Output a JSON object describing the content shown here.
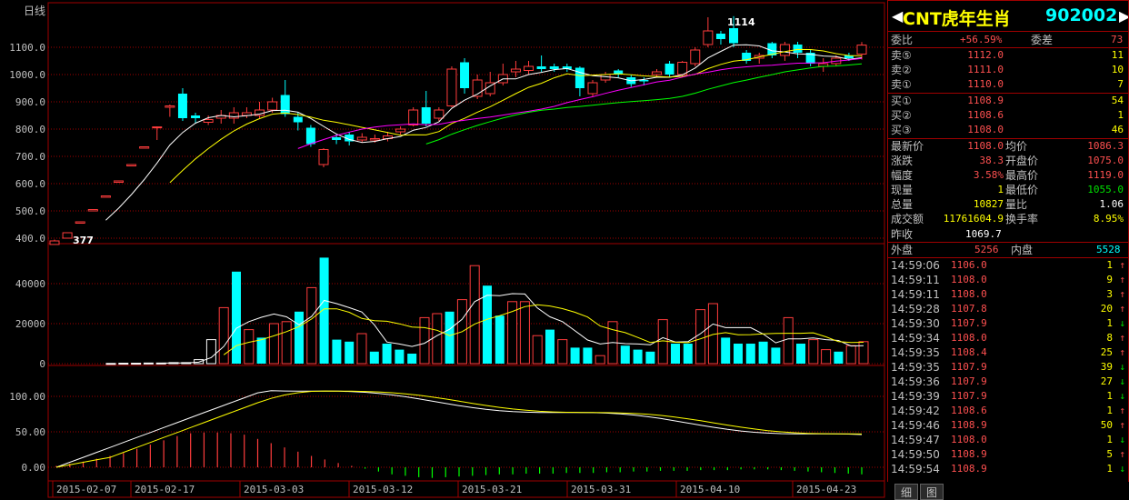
{
  "chart": {
    "period_label": "日线",
    "peak_label": "1114",
    "low_label": "377",
    "price_axis": [
      "1100.0",
      "1000.0",
      "900.0",
      "800.0",
      "700.0",
      "600.0",
      "500.0",
      "400.0"
    ],
    "volume_axis": [
      "40000",
      "20000",
      "0"
    ],
    "macd_axis": [
      "100.00",
      "50.00",
      "0.00"
    ],
    "dates": [
      "2015-02-07",
      "2015-02-17",
      "2015-03-03",
      "2015-03-12",
      "2015-03-21",
      "2015-03-31",
      "2015-04-10",
      "2015-04-23"
    ]
  },
  "chart_data": {
    "type": "candlestick",
    "y_range": [
      390,
      1140
    ],
    "candles": [
      {
        "o": 377,
        "c": 390,
        "h": 395,
        "l": 377
      },
      {
        "o": 400,
        "c": 420,
        "h": 420,
        "l": 400
      },
      {
        "o": 455,
        "c": 460,
        "h": 460,
        "l": 455
      },
      {
        "o": 500,
        "c": 505,
        "h": 505,
        "l": 500
      },
      {
        "o": 550,
        "c": 555,
        "h": 555,
        "l": 550
      },
      {
        "o": 605,
        "c": 610,
        "h": 610,
        "l": 605
      },
      {
        "o": 665,
        "c": 670,
        "h": 670,
        "l": 665
      },
      {
        "o": 730,
        "c": 735,
        "h": 735,
        "l": 730
      },
      {
        "o": 805,
        "c": 808,
        "h": 810,
        "l": 760
      },
      {
        "o": 880,
        "c": 885,
        "h": 890,
        "l": 845
      },
      {
        "o": 930,
        "c": 840,
        "h": 950,
        "l": 830
      },
      {
        "o": 850,
        "c": 840,
        "h": 860,
        "l": 820
      },
      {
        "o": 825,
        "c": 835,
        "h": 850,
        "l": 815
      },
      {
        "o": 840,
        "c": 850,
        "h": 870,
        "l": 820
      },
      {
        "o": 840,
        "c": 860,
        "h": 880,
        "l": 820
      },
      {
        "o": 850,
        "c": 860,
        "h": 880,
        "l": 840
      },
      {
        "o": 850,
        "c": 870,
        "h": 900,
        "l": 840
      },
      {
        "o": 870,
        "c": 900,
        "h": 915,
        "l": 860
      },
      {
        "o": 925,
        "c": 855,
        "h": 980,
        "l": 845
      },
      {
        "o": 845,
        "c": 825,
        "h": 860,
        "l": 795
      },
      {
        "o": 805,
        "c": 745,
        "h": 815,
        "l": 735
      },
      {
        "o": 670,
        "c": 725,
        "h": 730,
        "l": 660
      },
      {
        "o": 770,
        "c": 760,
        "h": 780,
        "l": 745
      },
      {
        "o": 780,
        "c": 755,
        "h": 790,
        "l": 740
      },
      {
        "o": 760,
        "c": 770,
        "h": 785,
        "l": 750
      },
      {
        "o": 760,
        "c": 765,
        "h": 780,
        "l": 750
      },
      {
        "o": 765,
        "c": 775,
        "h": 790,
        "l": 755
      },
      {
        "o": 790,
        "c": 800,
        "h": 810,
        "l": 780
      },
      {
        "o": 815,
        "c": 870,
        "h": 880,
        "l": 810
      },
      {
        "o": 880,
        "c": 820,
        "h": 940,
        "l": 810
      },
      {
        "o": 840,
        "c": 870,
        "h": 880,
        "l": 830
      },
      {
        "o": 885,
        "c": 1020,
        "h": 1030,
        "l": 880
      },
      {
        "o": 1045,
        "c": 950,
        "h": 1060,
        "l": 930
      },
      {
        "o": 920,
        "c": 980,
        "h": 1000,
        "l": 910
      },
      {
        "o": 930,
        "c": 970,
        "h": 1010,
        "l": 920
      },
      {
        "o": 970,
        "c": 1000,
        "h": 1040,
        "l": 960
      },
      {
        "o": 1010,
        "c": 1020,
        "h": 1050,
        "l": 990
      },
      {
        "o": 1015,
        "c": 1030,
        "h": 1050,
        "l": 1000
      },
      {
        "o": 1030,
        "c": 1020,
        "h": 1070,
        "l": 1010
      },
      {
        "o": 1030,
        "c": 1020,
        "h": 1040,
        "l": 1010
      },
      {
        "o": 1030,
        "c": 1020,
        "h": 1040,
        "l": 1010
      },
      {
        "o": 1025,
        "c": 950,
        "h": 1030,
        "l": 920
      },
      {
        "o": 930,
        "c": 970,
        "h": 980,
        "l": 920
      },
      {
        "o": 980,
        "c": 1000,
        "h": 1010,
        "l": 970
      },
      {
        "o": 1015,
        "c": 1000,
        "h": 1020,
        "l": 990
      },
      {
        "o": 990,
        "c": 965,
        "h": 1000,
        "l": 955
      },
      {
        "o": 980,
        "c": 975,
        "h": 990,
        "l": 960
      },
      {
        "o": 1000,
        "c": 1010,
        "h": 1020,
        "l": 990
      },
      {
        "o": 1040,
        "c": 1000,
        "h": 1050,
        "l": 990
      },
      {
        "o": 1000,
        "c": 1045,
        "h": 1050,
        "l": 990
      },
      {
        "o": 1040,
        "c": 1090,
        "h": 1100,
        "l": 1030
      },
      {
        "o": 1110,
        "c": 1160,
        "h": 1210,
        "l": 1100
      },
      {
        "o": 1150,
        "c": 1130,
        "h": 1160,
        "l": 1110
      },
      {
        "o": 1170,
        "c": 1115,
        "h": 1214,
        "l": 1100
      },
      {
        "o": 1080,
        "c": 1050,
        "h": 1090,
        "l": 1040
      },
      {
        "o": 1060,
        "c": 1070,
        "h": 1080,
        "l": 1040
      },
      {
        "o": 1115,
        "c": 1070,
        "h": 1120,
        "l": 1060
      },
      {
        "o": 1070,
        "c": 1110,
        "h": 1120,
        "l": 1050
      },
      {
        "o": 1110,
        "c": 1080,
        "h": 1120,
        "l": 1060
      },
      {
        "o": 1080,
        "c": 1040,
        "h": 1090,
        "l": 1030
      },
      {
        "o": 1030,
        "c": 1040,
        "h": 1060,
        "l": 1010
      },
      {
        "o": 1040,
        "c": 1060,
        "h": 1070,
        "l": 1030
      },
      {
        "o": 1070,
        "c": 1060,
        "h": 1080,
        "l": 1050
      },
      {
        "o": 1075,
        "c": 1108,
        "h": 1119,
        "l": 1055
      }
    ],
    "volume": [
      {
        "v": 100,
        "d": 0
      },
      {
        "v": 200,
        "d": 0
      },
      {
        "v": 200,
        "d": 0
      },
      {
        "v": 300,
        "d": 0
      },
      {
        "v": 300,
        "d": 0
      },
      {
        "v": 500,
        "d": 0
      },
      {
        "v": 500,
        "d": 0
      },
      {
        "v": 2000,
        "d": 0
      },
      {
        "v": 12000,
        "d": 0
      },
      {
        "v": 28000,
        "d": 1
      },
      {
        "v": 46000,
        "d": -1
      },
      {
        "v": 17000,
        "d": 1
      },
      {
        "v": 13000,
        "d": -1
      },
      {
        "v": 20000,
        "d": 1
      },
      {
        "v": 21000,
        "d": 1
      },
      {
        "v": 26000,
        "d": -1
      },
      {
        "v": 38000,
        "d": 1
      },
      {
        "v": 53000,
        "d": -1
      },
      {
        "v": 12000,
        "d": -1
      },
      {
        "v": 11000,
        "d": -1
      },
      {
        "v": 15000,
        "d": 1
      },
      {
        "v": 6000,
        "d": -1
      },
      {
        "v": 10000,
        "d": -1
      },
      {
        "v": 7000,
        "d": -1
      },
      {
        "v": 5000,
        "d": -1
      },
      {
        "v": 23000,
        "d": 1
      },
      {
        "v": 25000,
        "d": 1
      },
      {
        "v": 26000,
        "d": -1
      },
      {
        "v": 32000,
        "d": 1
      },
      {
        "v": 49000,
        "d": 1
      },
      {
        "v": 39000,
        "d": -1
      },
      {
        "v": 24000,
        "d": -1
      },
      {
        "v": 31000,
        "d": 1
      },
      {
        "v": 31000,
        "d": 1
      },
      {
        "v": 14000,
        "d": 1
      },
      {
        "v": 17000,
        "d": -1
      },
      {
        "v": 12000,
        "d": 1
      },
      {
        "v": 8000,
        "d": -1
      },
      {
        "v": 8000,
        "d": -1
      },
      {
        "v": 4000,
        "d": 1
      },
      {
        "v": 21000,
        "d": 1
      },
      {
        "v": 9000,
        "d": -1
      },
      {
        "v": 7000,
        "d": -1
      },
      {
        "v": 6000,
        "d": -1
      },
      {
        "v": 22000,
        "d": 1
      },
      {
        "v": 10000,
        "d": -1
      },
      {
        "v": 10000,
        "d": -1
      },
      {
        "v": 27000,
        "d": 1
      },
      {
        "v": 30000,
        "d": 1
      },
      {
        "v": 13000,
        "d": -1
      },
      {
        "v": 10000,
        "d": -1
      },
      {
        "v": 10000,
        "d": -1
      },
      {
        "v": 11000,
        "d": -1
      },
      {
        "v": 8000,
        "d": -1
      },
      {
        "v": 23000,
        "d": 1
      },
      {
        "v": 10000,
        "d": -1
      },
      {
        "v": 12000,
        "d": 1
      },
      {
        "v": 7000,
        "d": 1
      },
      {
        "v": 6000,
        "d": -1
      },
      {
        "v": 9000,
        "d": 1
      },
      {
        "v": 11000,
        "d": 1
      }
    ],
    "macd_hist": [
      2,
      5,
      8,
      12,
      16,
      20,
      26,
      32,
      38,
      44,
      48,
      49,
      49,
      48,
      46,
      40,
      34,
      28,
      22,
      16,
      11,
      6,
      2,
      -2,
      -6,
      -10,
      -12,
      -14,
      -15,
      -14,
      -13,
      -12,
      -11,
      -10,
      -10,
      -9,
      -9,
      -9,
      -8,
      -8,
      -8,
      -7,
      -7,
      -6,
      -6,
      -5,
      -5,
      -5,
      -4,
      -4,
      -4,
      -3,
      -3,
      -3,
      -4,
      -5,
      -6,
      -7,
      -8,
      -9,
      -10
    ]
  },
  "quote": {
    "name": "CNT虎年生肖",
    "code": "902002",
    "weibi_label": "委比",
    "weibi": "+56.59%",
    "weicha_label": "委差",
    "weicha": "73",
    "asks": [
      {
        "label": "卖⑤",
        "price": "1112.0",
        "vol": "11"
      },
      {
        "label": "卖②",
        "price": "1111.0",
        "vol": "10"
      },
      {
        "label": "卖①",
        "price": "1110.0",
        "vol": "7"
      }
    ],
    "bids": [
      {
        "label": "买①",
        "price": "1108.9",
        "vol": "54"
      },
      {
        "label": "买②",
        "price": "1108.6",
        "vol": "1"
      },
      {
        "label": "买③",
        "price": "1108.0",
        "vol": "46"
      }
    ],
    "stats": [
      {
        "l1": "最新价",
        "v1": "1108.0",
        "l2": "均价",
        "v2": "1086.3"
      },
      {
        "l1": "涨跌",
        "v1": "38.3",
        "l2": "开盘价",
        "v2": "1075.0"
      },
      {
        "l1": "幅度",
        "v1": "3.58%",
        "l2": "最高价",
        "v2": "1119.0"
      },
      {
        "l1": "现量",
        "v1": "1",
        "l2": "最低价",
        "v2": "1055.0"
      },
      {
        "l1": "总量",
        "v1": "10827",
        "l2": "量比",
        "v2": "1.06"
      },
      {
        "l1": "成交额",
        "v1": "11761604.9",
        "l2": "换手率",
        "v2": "8.95%"
      }
    ],
    "prev_close_label": "昨收",
    "prev_close": "1069.7",
    "outer_label": "外盘",
    "outer": "5256",
    "inner_label": "内盘",
    "inner": "5528",
    "ticks": [
      {
        "t": "14:59:06",
        "p": "1106.0",
        "v": "1",
        "d": "up"
      },
      {
        "t": "14:59:11",
        "p": "1108.0",
        "v": "9",
        "d": "up"
      },
      {
        "t": "14:59:11",
        "p": "1108.0",
        "v": "3",
        "d": "up"
      },
      {
        "t": "14:59:28",
        "p": "1107.8",
        "v": "20",
        "d": "up"
      },
      {
        "t": "14:59:30",
        "p": "1107.9",
        "v": "1",
        "d": "down"
      },
      {
        "t": "14:59:34",
        "p": "1108.0",
        "v": "8",
        "d": "up"
      },
      {
        "t": "14:59:35",
        "p": "1108.4",
        "v": "25",
        "d": "up"
      },
      {
        "t": "14:59:35",
        "p": "1107.9",
        "v": "39",
        "d": "down"
      },
      {
        "t": "14:59:36",
        "p": "1107.9",
        "v": "27",
        "d": "down"
      },
      {
        "t": "14:59:39",
        "p": "1107.9",
        "v": "1",
        "d": "down"
      },
      {
        "t": "14:59:42",
        "p": "1108.6",
        "v": "1",
        "d": "up"
      },
      {
        "t": "14:59:46",
        "p": "1108.9",
        "v": "50",
        "d": "up"
      },
      {
        "t": "14:59:47",
        "p": "1108.0",
        "v": "1",
        "d": "down"
      },
      {
        "t": "14:59:50",
        "p": "1108.9",
        "v": "5",
        "d": "up"
      },
      {
        "t": "14:59:54",
        "p": "1108.9",
        "v": "1",
        "d": "down"
      }
    ],
    "up_arrow": "↑",
    "down_arrow": "↓"
  },
  "tabs": [
    "细",
    "图"
  ],
  "colors": {
    "up": "#ff3c3c",
    "down": "#00ffff",
    "grid": "#a00000",
    "ma5": "#ffffff",
    "ma10": "#ffff00",
    "ma20": "#ff00ff",
    "ma60": "#00ff00"
  }
}
